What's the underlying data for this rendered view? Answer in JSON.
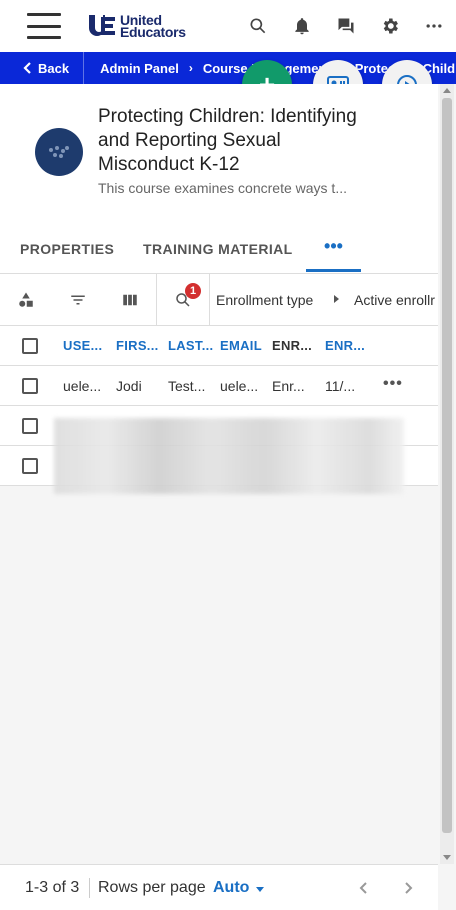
{
  "header": {
    "logo": {
      "line1": "United",
      "line2": "Educators"
    },
    "icons": [
      "hamburger-icon",
      "search-icon",
      "bell-icon",
      "chat-icon",
      "gear-icon",
      "more-horizontal-icon"
    ]
  },
  "breadcrumb": {
    "back_label": "Back",
    "items": [
      "Admin Panel",
      "Course Management",
      "Protecting Children"
    ]
  },
  "fabs": {
    "add_symbol": "+"
  },
  "course": {
    "title": "Protecting Children: Identifying and Reporting Sexual Misconduct K-12",
    "description": "This course examines concrete ways t..."
  },
  "tabs": {
    "items": [
      "PROPERTIES",
      "TRAINING MATERIAL"
    ],
    "more": "•••"
  },
  "toolbar": {
    "search_badge": "1",
    "filters": [
      "Enrollment type",
      "Active enrollr"
    ]
  },
  "table": {
    "columns": [
      "USE...",
      "FIRS...",
      "LAST...",
      "EMAIL",
      "ENR...",
      "ENR..."
    ],
    "rows": [
      [
        "uele...",
        "Jodi",
        "Test...",
        "uele...",
        "Enr...",
        "11/..."
      ]
    ],
    "row_more": "•••"
  },
  "footer": {
    "count": "1-3 of 3",
    "rows_per_page_label": "Rows per page",
    "rows_per_page_value": "Auto"
  },
  "colors": {
    "accent": "#1a6fc4",
    "breadcrumb_bg": "#0a28d8",
    "fab_add": "#119a6a",
    "badge": "#d32f2f"
  }
}
